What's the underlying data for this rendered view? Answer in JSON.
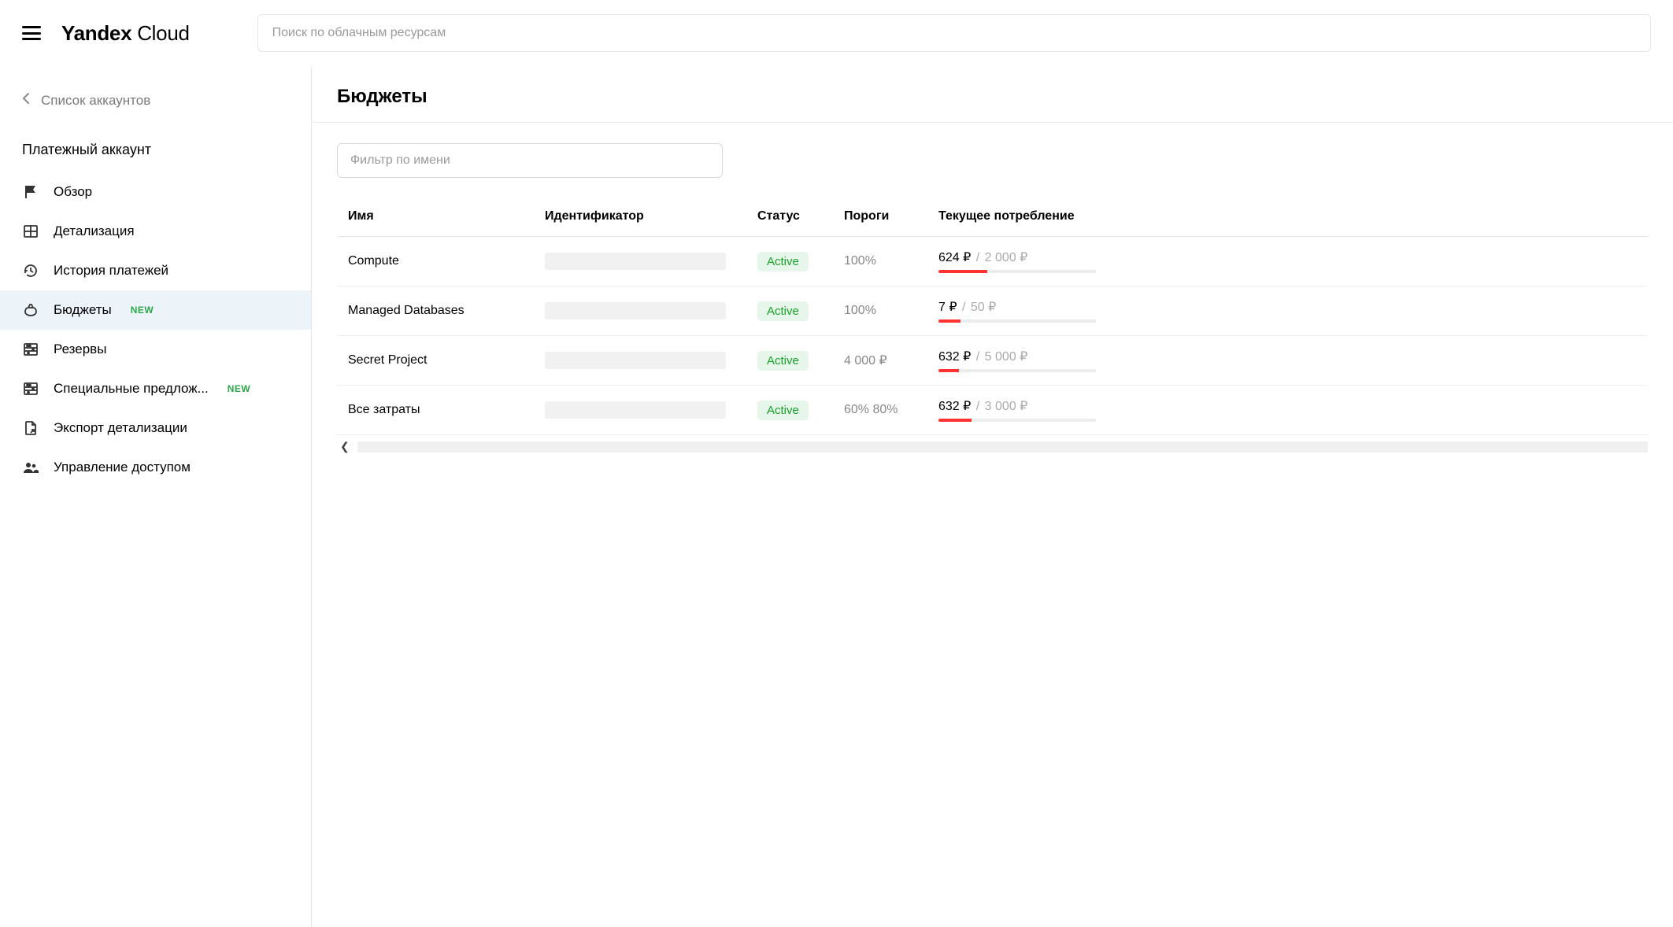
{
  "header": {
    "logo_bold": "Yandex",
    "logo_light": "Cloud",
    "search_placeholder": "Поиск по облачным ресурсам"
  },
  "sidebar": {
    "back_label": "Список аккаунтов",
    "section_title": "Платежный аккаунт",
    "badge_new": "NEW",
    "items": [
      {
        "label": "Обзор",
        "icon": "flag-icon"
      },
      {
        "label": "Детализация",
        "icon": "grid-icon"
      },
      {
        "label": "История платежей",
        "icon": "history-icon"
      },
      {
        "label": "Бюджеты",
        "icon": "bag-icon",
        "active": true,
        "new": true
      },
      {
        "label": "Резервы",
        "icon": "abacus-icon"
      },
      {
        "label": "Специальные предлож...",
        "icon": "abacus-icon",
        "new": true
      },
      {
        "label": "Экспорт детализации",
        "icon": "export-icon"
      },
      {
        "label": "Управление доступом",
        "icon": "people-icon"
      }
    ]
  },
  "page": {
    "title": "Бюджеты",
    "filter_placeholder": "Фильтр по имени",
    "columns": {
      "name": "Имя",
      "id": "Идентификатор",
      "status": "Статус",
      "thresholds": "Пороги",
      "consumption": "Текущее потребление"
    },
    "rows": [
      {
        "name": "Compute",
        "status": "Active",
        "thresholds": "100%",
        "current": "624 ₽",
        "total": "2 000 ₽",
        "pct": 31
      },
      {
        "name": "Managed Databases",
        "status": "Active",
        "thresholds": "100%",
        "current": "7 ₽",
        "total": "50 ₽",
        "pct": 14
      },
      {
        "name": "Secret Project",
        "status": "Active",
        "thresholds": "4 000 ₽",
        "current": "632 ₽",
        "total": "5 000 ₽",
        "pct": 13
      },
      {
        "name": "Все затраты",
        "status": "Active",
        "thresholds": "60%  80%",
        "current": "632 ₽",
        "total": "3 000 ₽",
        "pct": 21
      }
    ]
  }
}
